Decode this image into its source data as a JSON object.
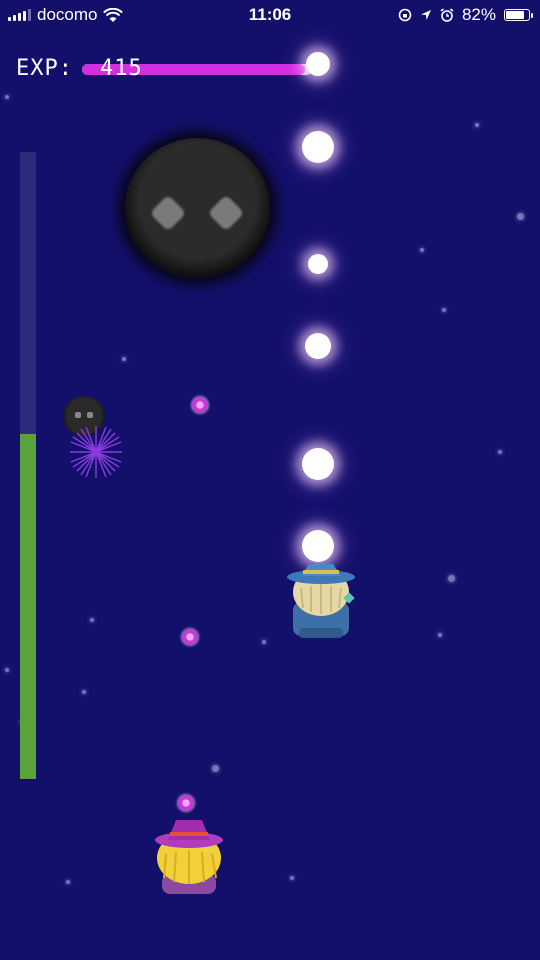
{
  "status_bar": {
    "carrier": "docomo",
    "time": "11:06",
    "battery": "82%",
    "battery_level": 0.82,
    "icons": [
      "signal-icon",
      "wifi-icon",
      "lock-rotation-icon",
      "location-icon",
      "alarm-icon",
      "battery-icon"
    ]
  },
  "hud": {
    "exp_label": "EXP:",
    "exp_value": "415",
    "exp_progress": 0.97,
    "hp_progress": 0.55,
    "colors": {
      "exp_fill": "#d12fe0",
      "hp_fill": "#5aa23a",
      "background": "#13106b"
    }
  },
  "entities": {
    "boss": "shadow-blob-boss",
    "minion": "shadow-blob-minion",
    "ally": "blue-hat-witch",
    "player": "purple-hat-witch"
  }
}
